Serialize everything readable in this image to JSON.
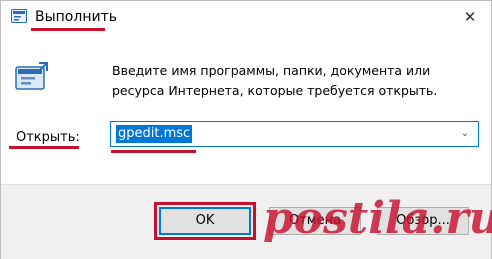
{
  "window": {
    "title": "Выполнить",
    "close_glyph": "✕"
  },
  "body": {
    "description": "Введите имя программы, папки, документа или ресурса Интернета, которые требуется открыть.",
    "open_label": "Открыть:",
    "command_value": "gpedit.msc",
    "dropdown_glyph": "⌄"
  },
  "buttons": {
    "ok": "OK",
    "cancel": "Отмена",
    "browse": "Обзор..."
  },
  "watermark": "postila.ru",
  "colors": {
    "highlight": "#c8102e",
    "accent": "#0078d7"
  },
  "icons": [
    "run-app-icon",
    "run-dialog-icon",
    "close-icon",
    "chevron-down-icon"
  ]
}
